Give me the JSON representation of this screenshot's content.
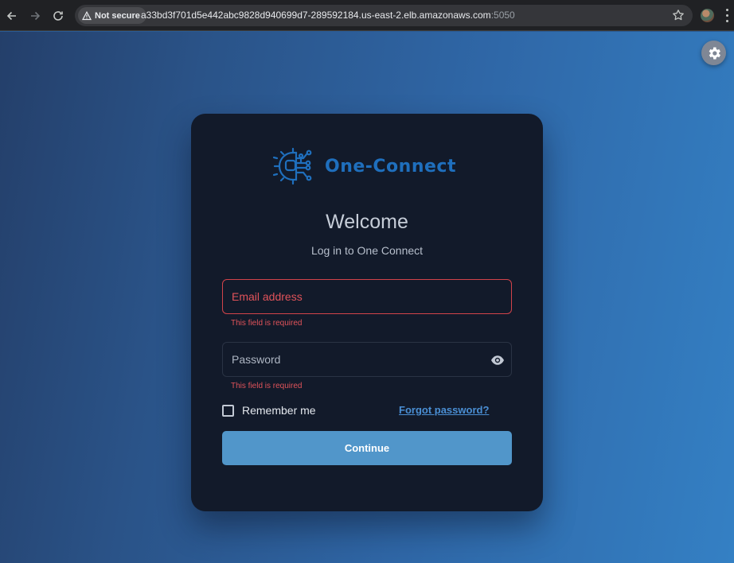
{
  "browser": {
    "security_chip": "Not secure",
    "url_host": "a33bd3f701d5e442abc9828d940699d7-289592184.us-east-2.elb.amazonaws.com",
    "url_port": ":5050",
    "icons": [
      "back-icon",
      "forward-icon",
      "reload-icon",
      "warning-icon",
      "star-icon",
      "profile-avatar",
      "kebab-menu-icon"
    ]
  },
  "app": {
    "brand": "One-Connect",
    "welcome": "Welcome",
    "subtitle": "Log in to One Connect",
    "email": {
      "placeholder": "Email address",
      "value": "",
      "error": "This field is required"
    },
    "password": {
      "placeholder": "Password",
      "value": "",
      "error": "This field is required"
    },
    "remember_label": "Remember me",
    "remember_checked": false,
    "forgot_label": "Forgot password?",
    "continue_label": "Continue",
    "settings_icon": "gear-icon"
  },
  "colors": {
    "card": "#121a2a",
    "brand": "#1f6fbd",
    "error": "#e0535a",
    "button": "#5196ca",
    "link": "#4a8fd4"
  }
}
